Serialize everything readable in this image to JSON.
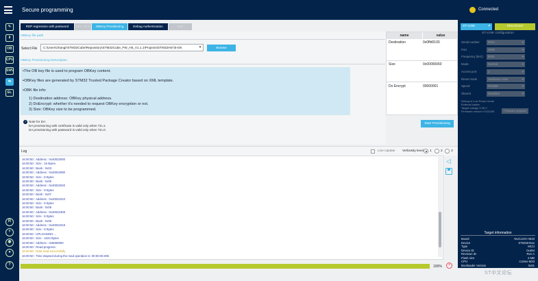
{
  "header": {
    "title": "Secure programming",
    "status": "Connected"
  },
  "sidebar": {
    "icons": [
      "edit-icon",
      "download-icon",
      "ob-icon",
      "cpu-icon",
      "swv-icon",
      "security-icon",
      "el-icon"
    ],
    "icon_text": [
      "✎",
      "⬇",
      "OB",
      "CPU",
      "SWV",
      "⇆",
      "EL"
    ],
    "bottom_icons": [
      "help-icon"
    ]
  },
  "tabs": [
    {
      "label": "RDP regression with password",
      "state": "normal"
    },
    {
      "label": "SFI / SFIx",
      "state": "disabled"
    },
    {
      "label": "OBKey Provisioning",
      "state": "selected"
    },
    {
      "label": "Debug Authentication",
      "state": "normal"
    },
    {
      "label": "SSP",
      "state": "disabled"
    }
  ],
  "obkey": {
    "section_file": "OBKey file path",
    "file_label": "Select File",
    "file_value": "C:\\Users\\zhangr\\STM32Cube\\Repository\\STM32Cube_FW_H5_V1.1.1\\Projects\\STM32H573I-DK",
    "browse": "Browse",
    "section_desc": "OBKey Provisioning Description",
    "desc": [
      "•The OB key file is used to program OBKey content.",
      "•OBKey files are generated by STM32 Trusted Package Creator based on XML template.",
      "•OBK file info:",
      "1) Destination address: OBKey physical address.",
      "2) DoEncrypt: whether it's needed to request OBKey encryption or not.",
      "3) Size: OBKey size to be programmed."
    ],
    "note": [
      "Note for DA:",
      "DA provisioning with certificate is valid only when TZ=1.",
      "DA provisioning with password is valid only when TZ=0."
    ],
    "table": {
      "headers": [
        "name",
        "value"
      ],
      "rows": [
        [
          "Destination",
          "0x0ffd0100"
        ],
        [
          "Size",
          "0x00000060"
        ],
        [
          "Do Encrypt",
          "00000001"
        ]
      ]
    },
    "start": "Start Provisioning"
  },
  "log": {
    "title": "Log",
    "live_update": "Live Update",
    "verbosity_label": "Verbosity level",
    "levels": [
      "1",
      "2",
      "3"
    ],
    "selected_level": "1",
    "lines": [
      {
        "t": "16:00:50 : Address   : 0x40022000",
        "c": "b"
      },
      {
        "t": "16:00:50 : Size      : 16 Bytes",
        "c": "b"
      },
      {
        "t": "16:00:50 : Bank      : 0x03",
        "c": "b"
      },
      {
        "t": "16:00:50 : Address   : 0x40022080",
        "c": "b"
      },
      {
        "t": "16:00:50 : Size      : 8 Bytes",
        "c": "b"
      },
      {
        "t": "16:00:50 : Bank      : 0x05",
        "c": "b"
      },
      {
        "t": "16:00:50 : Address   : 0x40022040",
        "c": "b"
      },
      {
        "t": "16:00:50 : Size      : 8 Bytes",
        "c": "b"
      },
      {
        "t": "16:00:50 : Bank      : 0x07",
        "c": "b"
      },
      {
        "t": "16:00:50 : Address   : 0x40022310",
        "c": "b"
      },
      {
        "t": "16:00:50 : Size      : 8 Bytes",
        "c": "b"
      },
      {
        "t": "16:00:50 : Bank      : 0x08",
        "c": "b"
      },
      {
        "t": "16:00:50 : Address   : 0x40022308",
        "c": "b"
      },
      {
        "t": "16:00:50 : Size      : 8 Bytes",
        "c": "b"
      },
      {
        "t": "16:00:50 : Bank      : 0x09",
        "c": "b"
      },
      {
        "t": "16:00:50 : Address   : 0x40022318",
        "c": "b"
      },
      {
        "t": "16:00:50 : Size      : 8 Bytes",
        "c": "b"
      },
      {
        "t": "16:00:50 : UPLOADING ...",
        "c": "b"
      },
      {
        "t": "16:00:50 : Size      : 1024 Bytes",
        "c": "b"
      },
      {
        "t": "16:00:50 : Address   : 0x8000000",
        "c": "b"
      },
      {
        "t": "16:00:50 : Read progress:",
        "c": "b"
      },
      {
        "t": "16:00:50 : Data read successfully",
        "c": "y"
      },
      {
        "t": "16:00:50 : Time elapsed during the read operation is: 00:00:00.005",
        "c": "b"
      }
    ]
  },
  "progress": {
    "value": 1.0,
    "label": "100%"
  },
  "right_panel": {
    "interface": "ST-LINK",
    "disconnect": "Disconnect",
    "config_title": "ST-LINK configuration",
    "config": [
      {
        "key": "Serial number",
        "value": "003A..."
      },
      {
        "key": "Port",
        "value": "SWD"
      },
      {
        "key": "Frequency (kHz)",
        "value": "8000"
      },
      {
        "key": "Mode",
        "value": "Normal"
      },
      {
        "key": "Access port",
        "value": "1"
      },
      {
        "key": "Reset mode",
        "value": "Hardware reset"
      },
      {
        "key": "Speed",
        "value": "Reliable"
      },
      {
        "key": "Shared",
        "value": "Disabled"
      }
    ],
    "extra": [
      "Debug in Low Power mode",
      "External loader",
      "Target voltage     3.28 V",
      "Firmware version  V3J11M3"
    ],
    "update_fw": "Firmware upgrade",
    "target_title": "Target information",
    "target": [
      {
        "k": "Board",
        "v": "NUCLEO-H533"
      },
      {
        "k": "Device",
        "v": "STM32H5xx"
      },
      {
        "k": "Type",
        "v": "MCU"
      },
      {
        "k": "Device ID",
        "v": "0x484"
      },
      {
        "k": "Revision ID",
        "v": "Rev A"
      },
      {
        "k": "Flash size",
        "v": "2 MB"
      },
      {
        "k": "CPU",
        "v": "Cortex-M33"
      },
      {
        "k": "Bootloader Version",
        "v": "0x81"
      }
    ]
  },
  "watermark": "ST中文论坛",
  "colors": {
    "navy": "#03234b",
    "accent": "#3cb4e6",
    "green": "#b6c92d",
    "status": "#e8c51a"
  }
}
